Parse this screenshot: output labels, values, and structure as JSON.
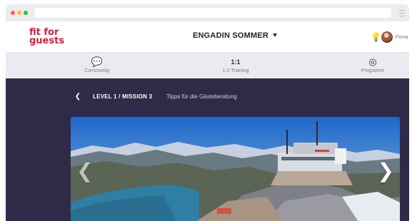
{
  "brand": {
    "line1": "fit for",
    "line2": "guests",
    "color": "#d71d3b"
  },
  "header": {
    "program": "ENGADIN SOMMER",
    "user_name": "Fiona"
  },
  "nav": {
    "items": [
      {
        "label": "Community",
        "icon": "chat-icon",
        "glyph": "💬"
      },
      {
        "label": "1:1-Training",
        "icon": "training-icon",
        "glyph": "1:1"
      },
      {
        "label": "Programm",
        "icon": "target-icon",
        "glyph": "◎"
      }
    ]
  },
  "mission": {
    "level": "LEVEL 1 / MISSION 3",
    "subtitle": "Tipps für die Gästeberatung"
  },
  "colors": {
    "panel": "#2f2a47",
    "sky": "#2c7bd7",
    "accent": "#d71d3b"
  }
}
